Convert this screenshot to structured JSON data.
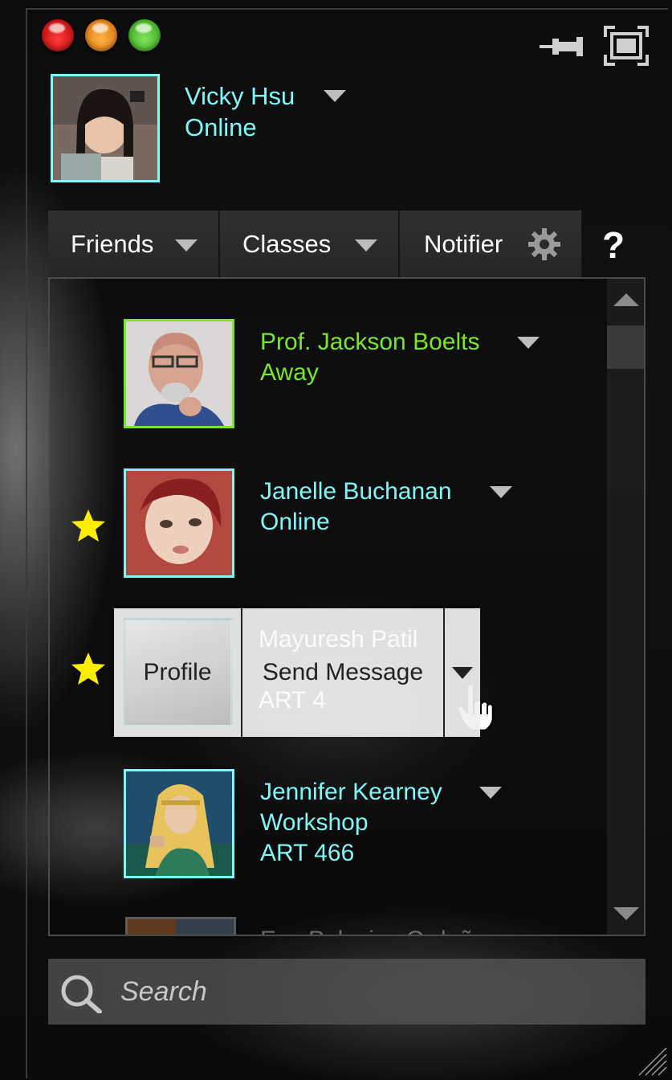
{
  "user": {
    "name": "Vicky Hsu",
    "status": "Online"
  },
  "tabs": {
    "friends": "Friends",
    "classes": "Classes",
    "notifier": "Notifier",
    "help": "?"
  },
  "contacts": [
    {
      "name": "Prof. Jackson Boelts",
      "line2": "Away",
      "line3": "",
      "starred": false,
      "state": "away"
    },
    {
      "name": "Janelle Buchanan",
      "line2": "Online",
      "line3": "",
      "starred": true,
      "state": "online"
    },
    {
      "name": "Mayuresh Patil",
      "line2": "",
      "line3": "ART 4",
      "starred": true,
      "state": "hover"
    },
    {
      "name": "Jennifer Kearney",
      "line2": "Workshop",
      "line3": "ART 466",
      "starred": false,
      "state": "online"
    },
    {
      "name": "Eva Palacios Orduño",
      "line2": "",
      "line3": "",
      "starred": false,
      "state": "online"
    }
  ],
  "hover_menu": {
    "profile": "Profile",
    "send_message": "Send Message"
  },
  "search": {
    "placeholder": "Search"
  },
  "colors": {
    "online": "#7ff7f7",
    "away": "#7ae62a",
    "star": "#ffee00"
  }
}
